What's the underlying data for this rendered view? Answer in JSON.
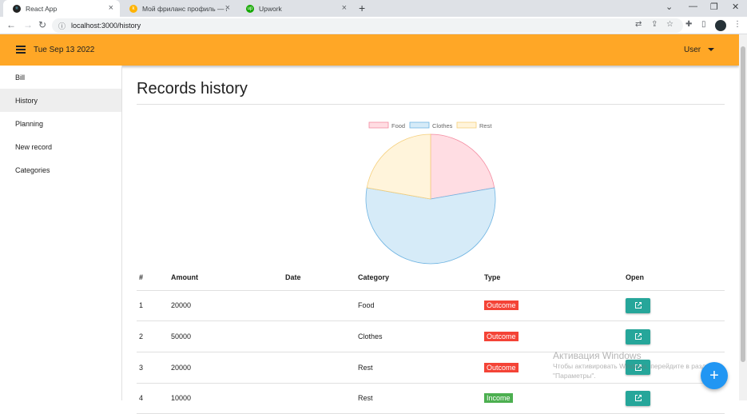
{
  "browser": {
    "tabs": [
      {
        "title": "React App",
        "active": true,
        "favicon": "react-icon",
        "color": "#61dafb"
      },
      {
        "title": "Мой фриланс профиль — Алд",
        "active": false,
        "favicon": "kwork-icon",
        "color": "#ffb300"
      },
      {
        "title": "Upwork",
        "active": false,
        "favicon": "upwork-icon",
        "color": "#14a800"
      }
    ],
    "url": "localhost:3000/history"
  },
  "header": {
    "date": "Tue Sep 13 2022",
    "user": "User",
    "color": "#ffa726"
  },
  "sidebar": {
    "items": [
      {
        "label": "Bill",
        "active": false
      },
      {
        "label": "History",
        "active": true
      },
      {
        "label": "Planning",
        "active": false
      },
      {
        "label": "New record",
        "active": false
      },
      {
        "label": "Categories",
        "active": false
      }
    ]
  },
  "main": {
    "title": "Records history"
  },
  "chart_data": {
    "type": "pie",
    "categories": [
      "Food",
      "Clothes",
      "Rest"
    ],
    "values": [
      20000,
      50000,
      20000
    ],
    "legend": "top",
    "colors": {
      "fill": [
        "#ffdde3",
        "#d6ebf8",
        "#fff4db"
      ],
      "stroke": [
        "#f48ca1",
        "#6fb4e2",
        "#f5cf7b"
      ]
    }
  },
  "table": {
    "headers": [
      "#",
      "Amount",
      "Date",
      "Category",
      "Type",
      "Open"
    ],
    "rows": [
      {
        "num": "1",
        "amount": "20000",
        "date": "",
        "category": "Food",
        "type": "Outcome",
        "type_color": "#f44336"
      },
      {
        "num": "2",
        "amount": "50000",
        "date": "",
        "category": "Clothes",
        "type": "Outcome",
        "type_color": "#f44336"
      },
      {
        "num": "3",
        "amount": "20000",
        "date": "",
        "category": "Rest",
        "type": "Outcome",
        "type_color": "#f44336"
      },
      {
        "num": "4",
        "amount": "10000",
        "date": "",
        "category": "Rest",
        "type": "Income",
        "type_color": "#4caf50"
      }
    ]
  },
  "fab": {
    "label": "+"
  },
  "watermark": {
    "line1": "Активация Windows",
    "line2": "Чтобы активировать Windows, перейдите в раздел",
    "line3": "\"Параметры\"."
  }
}
